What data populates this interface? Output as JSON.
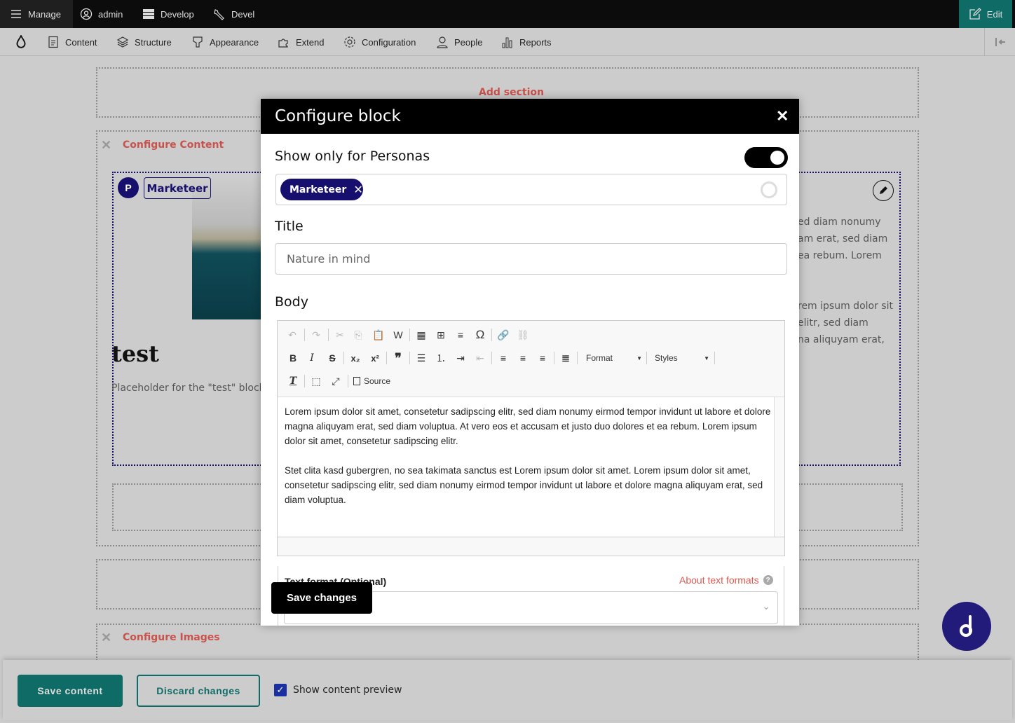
{
  "toolbar": {
    "manage": "Manage",
    "admin": "admin",
    "develop": "Develop",
    "devel": "Devel",
    "edit": "Edit"
  },
  "admin_menu": [
    {
      "label": "Content",
      "icon": "document-icon"
    },
    {
      "label": "Structure",
      "icon": "layers-icon"
    },
    {
      "label": "Appearance",
      "icon": "paint-icon"
    },
    {
      "label": "Extend",
      "icon": "puzzle-icon"
    },
    {
      "label": "Configuration",
      "icon": "gear-icon"
    },
    {
      "label": "People",
      "icon": "person-icon"
    },
    {
      "label": "Reports",
      "icon": "bar-chart-icon"
    }
  ],
  "page": {
    "add_section": "Add section",
    "configure_content": "Configure Content",
    "persona_badge": "P",
    "persona_tag": "Marketeer",
    "block_title": "test",
    "placeholder": "Placeholder for the \"test\" block",
    "right_text_1": [
      "ed diam nonumy",
      "am erat, sed diam",
      "ea rebum. Lorem"
    ],
    "right_text_2": [
      "rem ipsum dolor sit",
      "elitr, sed diam",
      "na aliquyam erat,"
    ],
    "configure_images": "Configure Images"
  },
  "modal": {
    "title": "Configure block",
    "personas_label": "Show only for Personas",
    "personas_enabled": true,
    "persona_chip": "Marketeer",
    "title_label": "Title",
    "title_value": "Nature in mind",
    "body_label": "Body",
    "format_label": "Format",
    "styles_label": "Styles",
    "source_label": "Source",
    "body_paragraphs": [
      "Lorem ipsum dolor sit amet, consetetur sadipscing elitr, sed diam nonumy eirmod tempor invidunt ut labore et dolore magna aliquyam erat, sed diam voluptua. At vero eos et accusam et justo duo dolores et ea rebum. Lorem ipsum dolor sit amet, consetetur sadipscing elitr.",
      "Stet clita kasd gubergren, no sea takimata sanctus est Lorem ipsum dolor sit amet. Lorem ipsum dolor sit amet, consetetur sadipscing elitr, sed diam nonumy eirmod tempor invidunt ut labore et dolore magna aliquyam erat, sed diam voluptua."
    ],
    "text_format_label": "Text format",
    "text_format_optional": "(Optional)",
    "about_text_formats": "About text formats",
    "save_changes": "Save changes"
  },
  "footer": {
    "save_content": "Save content",
    "discard_changes": "Discard changes",
    "show_preview": "Show content preview",
    "show_preview_checked": true
  },
  "colors": {
    "accent": "#0e6b66",
    "navy": "#170f6e",
    "link_red": "#c9524c"
  }
}
